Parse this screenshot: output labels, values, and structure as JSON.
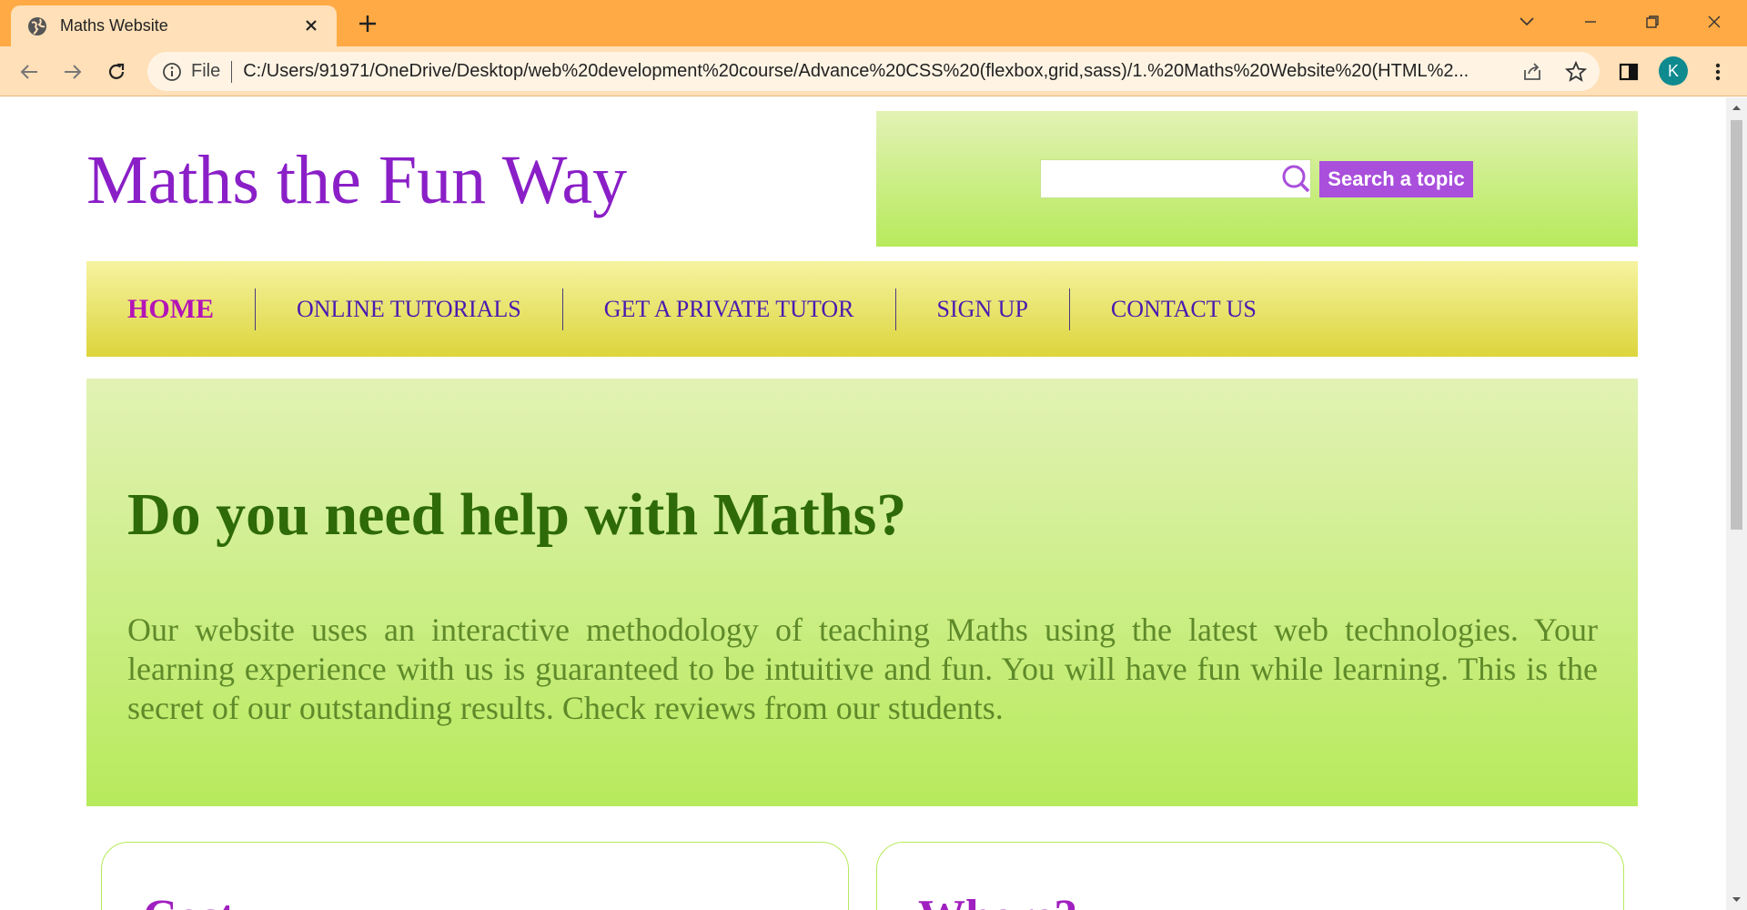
{
  "browser": {
    "tab_title": "Maths Website",
    "address_prefix": "File",
    "url": "C:/Users/91971/OneDrive/Desktop/web%20development%20course/Advance%20CSS%20(flexbox,grid,sass)/1.%20Maths%20Website%20(HTML%2...",
    "profile_initial": "K",
    "icons": [
      "globe-icon",
      "close-icon",
      "new-tab-icon",
      "tab-search-icon",
      "minimize-icon",
      "restore-icon",
      "window-close-icon",
      "back-icon",
      "forward-icon",
      "reload-icon",
      "info-icon",
      "share-icon",
      "star-icon",
      "side-panel-icon",
      "menu-icon"
    ]
  },
  "site": {
    "title": "Maths the Fun Way",
    "search": {
      "value": "",
      "button_label": "Search a topic"
    },
    "nav": [
      {
        "label": "HOME",
        "active": true
      },
      {
        "label": "ONLINE TUTORIALS",
        "active": false
      },
      {
        "label": "GET A PRIVATE TUTOR",
        "active": false
      },
      {
        "label": "SIGN UP",
        "active": false
      },
      {
        "label": "CONTACT US",
        "active": false
      }
    ],
    "hero": {
      "heading": "Do you need help with Maths?",
      "text": "Our website uses an interactive methodology of teaching Maths using the latest web technologies. Your learning experience with us is guaranteed to be intuitive and fun. You will have fun while learning. This is the secret of our outstanding results. Check reviews from our students."
    },
    "cards": [
      {
        "title": "Cost"
      },
      {
        "title": "Where?"
      }
    ]
  },
  "colors": {
    "tabbar": "#ffaa44",
    "toolbar": "#ffe0b8",
    "title_purple": "#8a1fc7",
    "nav_text": "#4a1ab0",
    "nav_active": "#b413b8",
    "hero_heading": "#2e6a07",
    "hero_text": "#5f8a2a",
    "button_purple": "#a94fdc",
    "green_light": "#e2f2b4",
    "green_dark": "#b7ea5c"
  }
}
